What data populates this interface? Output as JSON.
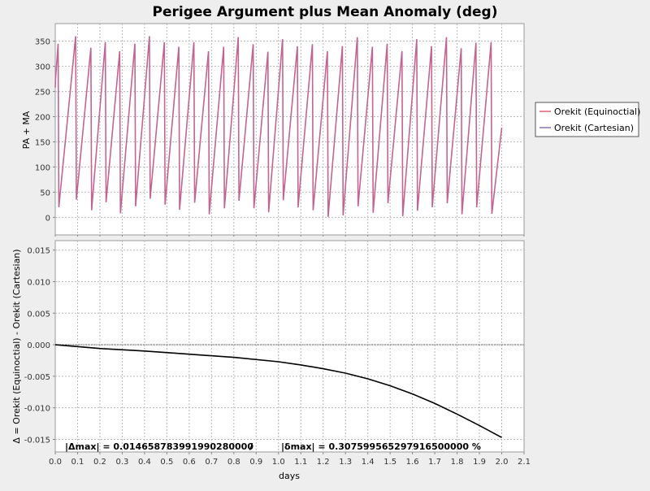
{
  "chart_data": [
    {
      "type": "line",
      "title": "Perigee Argument plus Mean Anomaly (deg)",
      "xlabel": "",
      "ylabel": "PA + MA",
      "xlim": [
        0.0,
        2.1
      ],
      "ylim": [
        -35,
        385
      ],
      "yticks": [
        0,
        50,
        100,
        150,
        200,
        250,
        300,
        350
      ],
      "grid": true,
      "legend_position": "right",
      "series": [
        {
          "name": "Orekit (Equinoctial)",
          "color": "#e0607a",
          "x": [
            0.0,
            0.0013,
            0.0128,
            0.0161,
            0.0914,
            0.0947,
            0.1596,
            0.1629,
            0.2243,
            0.2276,
            0.2887,
            0.292,
            0.3567,
            0.36,
            0.4219,
            0.4252,
            0.4887,
            0.492,
            0.5536,
            0.5569,
            0.6211,
            0.6244,
            0.6865,
            0.6898,
            0.7545,
            0.7578,
            0.8197,
            0.823,
            0.8867,
            0.89,
            0.9526,
            0.9559,
            1.0182,
            1.0215,
            1.0846,
            1.0879,
            1.1518,
            1.1551,
            1.2191,
            1.2224,
            1.2862,
            1.2895,
            1.3531,
            1.3564,
            1.4207,
            1.424,
            1.4869,
            1.4902,
            1.5532,
            1.5565,
            1.6193,
            1.6226,
            1.6855,
            1.6888,
            1.7525,
            1.7558,
            1.8185,
            1.8218,
            1.8845,
            1.8878,
            1.9524,
            1.9557,
            2.0
          ],
          "y": [
            258,
            274,
            345,
            20,
            360,
            35,
            337,
            14,
            348,
            30,
            330,
            8,
            345,
            22,
            360,
            37,
            348,
            25,
            339,
            15,
            348,
            29,
            330,
            6,
            339,
            18,
            358,
            33,
            344,
            18,
            329,
            10,
            354,
            34,
            340,
            20,
            344,
            14,
            330,
            1,
            340,
            4,
            358,
            22,
            339,
            9,
            345,
            28,
            330,
            2,
            354,
            13,
            340,
            20,
            358,
            28,
            336,
            6,
            347,
            20,
            348,
            7,
            178
          ]
        },
        {
          "name": "Orekit (Cartesian)",
          "color": "#8a70c0",
          "x": [
            0.0,
            0.0013,
            0.0128,
            0.0161,
            0.0914,
            0.0947,
            0.1596,
            0.1629,
            0.2243,
            0.2276,
            0.2887,
            0.292,
            0.3567,
            0.36,
            0.4219,
            0.4252,
            0.4887,
            0.492,
            0.5536,
            0.5569,
            0.6211,
            0.6244,
            0.6865,
            0.6898,
            0.7545,
            0.7578,
            0.8197,
            0.823,
            0.8867,
            0.89,
            0.9526,
            0.9559,
            1.0182,
            1.0215,
            1.0846,
            1.0879,
            1.1518,
            1.1551,
            1.2191,
            1.2224,
            1.2862,
            1.2895,
            1.3531,
            1.3564,
            1.4207,
            1.424,
            1.4869,
            1.4902,
            1.5532,
            1.5565,
            1.6193,
            1.6226,
            1.6855,
            1.6888,
            1.7525,
            1.7558,
            1.8185,
            1.8218,
            1.8845,
            1.8878,
            1.9524,
            1.9557,
            2.0
          ],
          "y": [
            258,
            274,
            345,
            20,
            360,
            35,
            337,
            14,
            348,
            30,
            330,
            8,
            345,
            22,
            360,
            37,
            348,
            25,
            339,
            15,
            348,
            29,
            330,
            6,
            339,
            18,
            358,
            33,
            344,
            18,
            329,
            10,
            354,
            34,
            340,
            20,
            344,
            14,
            330,
            1,
            340,
            4,
            358,
            22,
            339,
            9,
            345,
            28,
            330,
            2,
            354,
            13,
            340,
            20,
            358,
            28,
            336,
            6,
            347,
            20,
            348,
            7,
            178
          ]
        }
      ]
    },
    {
      "type": "line",
      "xlabel": "days",
      "ylabel": "Δ = Orekit (Equinoctial) - Orekit (Cartesian)",
      "xlim": [
        0.0,
        2.1
      ],
      "ylim": [
        -0.017,
        0.0165
      ],
      "xticks": [
        "0.0",
        "0.1",
        "0.2",
        "0.3",
        "0.4",
        "0.5",
        "0.6",
        "0.7",
        "0.8",
        "0.9",
        "1.0",
        "1.1",
        "1.2",
        "1.3",
        "1.4",
        "1.5",
        "1.6",
        "1.7",
        "1.8",
        "1.9",
        "2.0",
        "2.1"
      ],
      "yticks": [
        "-0.015",
        "-0.010",
        "-0.005",
        "0.000",
        "0.005",
        "0.010",
        "0.015"
      ],
      "grid": true,
      "zero_line": true,
      "series": [
        {
          "color": "#000000",
          "x": [
            0.0,
            0.2,
            0.4,
            0.6,
            0.8,
            1.0,
            1.1,
            1.2,
            1.3,
            1.4,
            1.5,
            1.6,
            1.7,
            1.8,
            1.9,
            2.0
          ],
          "y": [
            0.0,
            -0.0006,
            -0.001,
            -0.0015,
            -0.002,
            -0.0027,
            -0.0032,
            -0.0038,
            -0.0045,
            -0.0054,
            -0.0065,
            -0.0078,
            -0.0093,
            -0.011,
            -0.0128,
            -0.0147
          ]
        }
      ],
      "annotation": {
        "delta_max": "|Δmax| = 0.014658783991990280000",
        "separator": "/",
        "rel_max": "|δmax| = 0.307599565297916500000 %"
      }
    }
  ]
}
